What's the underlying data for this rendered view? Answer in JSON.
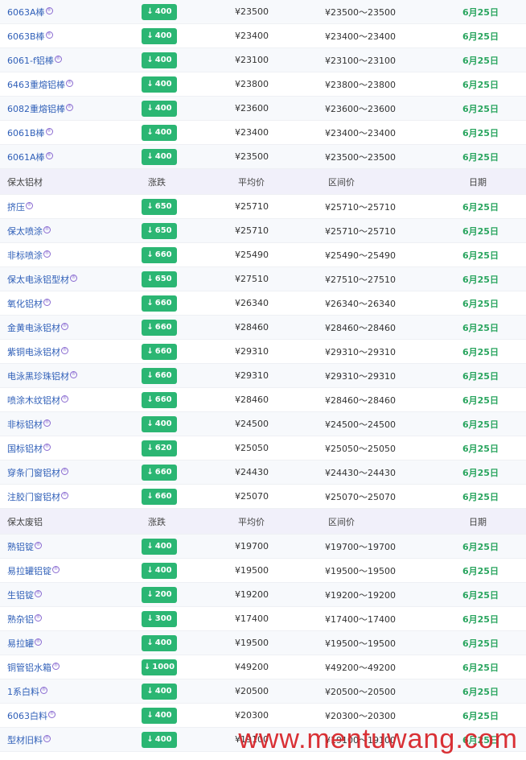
{
  "colors": {
    "header_bg": "#f1f0fa",
    "link": "#2f5fb8",
    "badge": "#2bb673",
    "date": "#2aa55f",
    "watermark": "#d8262b"
  },
  "watermark": "www.mentuwang.com",
  "sections": [
    {
      "header": null,
      "rows": [
        {
          "name": "6063A棒",
          "change": "400",
          "avg": "¥23500",
          "range": "¥23500～23500",
          "date": "6月25日"
        },
        {
          "name": "6063B棒",
          "change": "400",
          "avg": "¥23400",
          "range": "¥23400～23400",
          "date": "6月25日"
        },
        {
          "name": "6061-f铝棒",
          "change": "400",
          "avg": "¥23100",
          "range": "¥23100～23100",
          "date": "6月25日"
        },
        {
          "name": "6463重熔铝棒",
          "change": "400",
          "avg": "¥23800",
          "range": "¥23800～23800",
          "date": "6月25日"
        },
        {
          "name": "6082重熔铝棒",
          "change": "400",
          "avg": "¥23600",
          "range": "¥23600～23600",
          "date": "6月25日"
        },
        {
          "name": "6061B棒",
          "change": "400",
          "avg": "¥23400",
          "range": "¥23400～23400",
          "date": "6月25日"
        },
        {
          "name": "6061A棒",
          "change": "400",
          "avg": "¥23500",
          "range": "¥23500～23500",
          "date": "6月25日"
        }
      ]
    },
    {
      "header": {
        "name": "保太铝材",
        "change": "涨跌",
        "avg": "平均价",
        "range": "区间价",
        "date": "日期"
      },
      "rows": [
        {
          "name": "挤压",
          "change": "650",
          "avg": "¥25710",
          "range": "¥25710～25710",
          "date": "6月25日"
        },
        {
          "name": "保太喷涂",
          "change": "650",
          "avg": "¥25710",
          "range": "¥25710～25710",
          "date": "6月25日"
        },
        {
          "name": "非标喷涂",
          "change": "660",
          "avg": "¥25490",
          "range": "¥25490～25490",
          "date": "6月25日"
        },
        {
          "name": "保太电泳铝型材",
          "change": "650",
          "avg": "¥27510",
          "range": "¥27510～27510",
          "date": "6月25日"
        },
        {
          "name": "氧化铝材",
          "change": "660",
          "avg": "¥26340",
          "range": "¥26340～26340",
          "date": "6月25日"
        },
        {
          "name": "金黄电泳铝材",
          "change": "660",
          "avg": "¥28460",
          "range": "¥28460～28460",
          "date": "6月25日"
        },
        {
          "name": "紫铜电泳铝材",
          "change": "660",
          "avg": "¥29310",
          "range": "¥29310～29310",
          "date": "6月25日"
        },
        {
          "name": "电泳黑珍珠铝材",
          "change": "660",
          "avg": "¥29310",
          "range": "¥29310～29310",
          "date": "6月25日"
        },
        {
          "name": "喷涂木纹铝材",
          "change": "660",
          "avg": "¥28460",
          "range": "¥28460～28460",
          "date": "6月25日"
        },
        {
          "name": "非标铝材",
          "change": "400",
          "avg": "¥24500",
          "range": "¥24500～24500",
          "date": "6月25日"
        },
        {
          "name": "国标铝材",
          "change": "620",
          "avg": "¥25050",
          "range": "¥25050～25050",
          "date": "6月25日"
        },
        {
          "name": "穿条门窗铝材",
          "change": "660",
          "avg": "¥24430",
          "range": "¥24430～24430",
          "date": "6月25日"
        },
        {
          "name": "注胶门窗铝材",
          "change": "660",
          "avg": "¥25070",
          "range": "¥25070～25070",
          "date": "6月25日"
        }
      ]
    },
    {
      "header": {
        "name": "保太废铝",
        "change": "涨跌",
        "avg": "平均价",
        "range": "区间价",
        "date": "日期"
      },
      "rows": [
        {
          "name": "熟铝锭",
          "change": "400",
          "avg": "¥19700",
          "range": "¥19700～19700",
          "date": "6月25日"
        },
        {
          "name": "易拉罐铝锭",
          "change": "400",
          "avg": "¥19500",
          "range": "¥19500～19500",
          "date": "6月25日"
        },
        {
          "name": "生铝锭",
          "change": "200",
          "avg": "¥19200",
          "range": "¥19200～19200",
          "date": "6月25日"
        },
        {
          "name": "熟杂铝",
          "change": "300",
          "avg": "¥17400",
          "range": "¥17400～17400",
          "date": "6月25日"
        },
        {
          "name": "易拉罐",
          "change": "400",
          "avg": "¥19500",
          "range": "¥19500～19500",
          "date": "6月25日"
        },
        {
          "name": "铜管铝水箱",
          "change": "1000",
          "avg": "¥49200",
          "range": "¥49200～49200",
          "date": "6月25日"
        },
        {
          "name": "1系白料",
          "change": "400",
          "avg": "¥20500",
          "range": "¥20500～20500",
          "date": "6月25日"
        },
        {
          "name": "6063白料",
          "change": "400",
          "avg": "¥20300",
          "range": "¥20300～20300",
          "date": "6月25日"
        },
        {
          "name": "型材旧料",
          "change": "400",
          "avg": "¥19100",
          "range": "¥19100～19100",
          "date": "6月25日"
        }
      ]
    }
  ]
}
